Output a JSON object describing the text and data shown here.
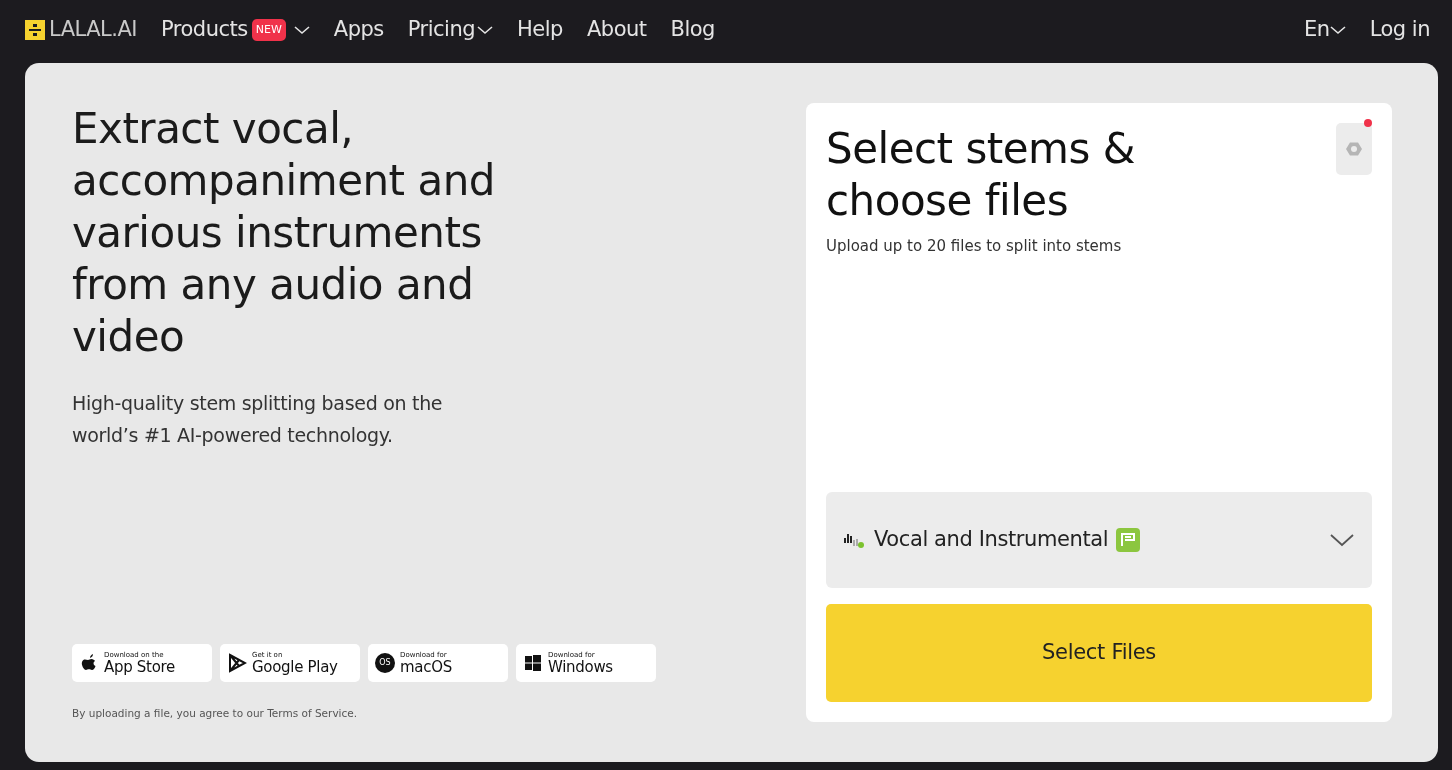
{
  "nav": {
    "logo": "LALAL.AI",
    "items": [
      {
        "label": "Products",
        "badge": "NEW",
        "caret": true
      },
      {
        "label": "Apps",
        "caret": false
      },
      {
        "label": "Pricing",
        "caret": true
      },
      {
        "label": "Help",
        "caret": false
      },
      {
        "label": "About",
        "caret": false
      },
      {
        "label": "Blog",
        "caret": false
      }
    ],
    "language": "En",
    "login": "Log in"
  },
  "hero": {
    "heading": "Extract vocal, accompaniment and various instruments from any audio and video",
    "subheading": "High-quality stem splitting based on the world’s #1 AI-powered technology."
  },
  "stores": [
    {
      "kind": "apple",
      "small": "Download on the",
      "big": "App Store"
    },
    {
      "kind": "play",
      "small": "Get it on",
      "big": "Google Play"
    },
    {
      "kind": "macos",
      "icon_text": "OS",
      "small": "Download for",
      "big": "macOS"
    },
    {
      "kind": "windows",
      "small": "Download for",
      "big": "Windows"
    }
  ],
  "terms": {
    "text": "By uploading a file, you agree to our",
    "link": "Terms of Service",
    "end": "."
  },
  "panel": {
    "title": "Select stems & choose files",
    "subtitle": "Upload up to 20 files to split into stems",
    "stem_select": "Vocal and Instrumental",
    "select_button": "Select Files"
  }
}
